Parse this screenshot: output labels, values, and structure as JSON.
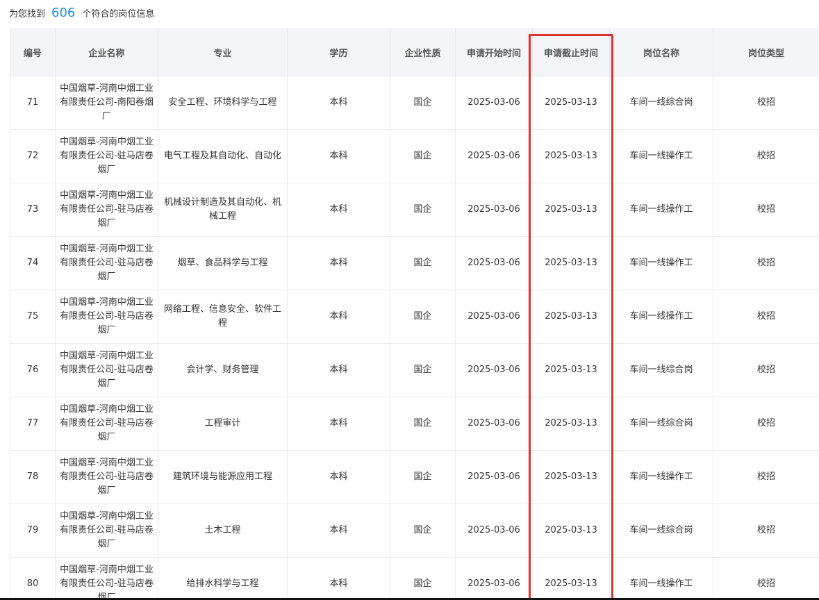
{
  "result": {
    "prefix": "为您找到",
    "count": "606",
    "suffix": "个符合的岗位信息"
  },
  "table": {
    "headers": [
      "编号",
      "企业名称",
      "专业",
      "学历",
      "企业性质",
      "申请开始时间",
      "申请截止时间",
      "岗位名称",
      "岗位类型"
    ],
    "rows": [
      {
        "id": "71",
        "company": "中国烟草-河南中烟工业有限责任公司-南阳卷烟厂",
        "major": "安全工程、环境科学与工程",
        "degree": "本科",
        "nature": "国企",
        "start": "2025-03-06",
        "end": "2025-03-13",
        "position": "车间一线综合岗",
        "type": "校招"
      },
      {
        "id": "72",
        "company": "中国烟草-河南中烟工业有限责任公司-驻马店卷烟厂",
        "major": "电气工程及其自动化、自动化",
        "degree": "本科",
        "nature": "国企",
        "start": "2025-03-06",
        "end": "2025-03-13",
        "position": "车间一线操作工",
        "type": "校招"
      },
      {
        "id": "73",
        "company": "中国烟草-河南中烟工业有限责任公司-驻马店卷烟厂",
        "major": "机械设计制造及其自动化、机械工程",
        "degree": "本科",
        "nature": "国企",
        "start": "2025-03-06",
        "end": "2025-03-13",
        "position": "车间一线操作工",
        "type": "校招"
      },
      {
        "id": "74",
        "company": "中国烟草-河南中烟工业有限责任公司-驻马店卷烟厂",
        "major": "烟草、食品科学与工程",
        "degree": "本科",
        "nature": "国企",
        "start": "2025-03-06",
        "end": "2025-03-13",
        "position": "车间一线操作工",
        "type": "校招"
      },
      {
        "id": "75",
        "company": "中国烟草-河南中烟工业有限责任公司-驻马店卷烟厂",
        "major": "网络工程、信息安全、软件工程",
        "degree": "本科",
        "nature": "国企",
        "start": "2025-03-06",
        "end": "2025-03-13",
        "position": "车间一线操作工",
        "type": "校招"
      },
      {
        "id": "76",
        "company": "中国烟草-河南中烟工业有限责任公司-驻马店卷烟厂",
        "major": "会计学、财务管理",
        "degree": "本科",
        "nature": "国企",
        "start": "2025-03-06",
        "end": "2025-03-13",
        "position": "车间一线综合岗",
        "type": "校招"
      },
      {
        "id": "77",
        "company": "中国烟草-河南中烟工业有限责任公司-驻马店卷烟厂",
        "major": "工程审计",
        "degree": "本科",
        "nature": "国企",
        "start": "2025-03-06",
        "end": "2025-03-13",
        "position": "车间一线综合岗",
        "type": "校招"
      },
      {
        "id": "78",
        "company": "中国烟草-河南中烟工业有限责任公司-驻马店卷烟厂",
        "major": "建筑环境与能源应用工程",
        "degree": "本科",
        "nature": "国企",
        "start": "2025-03-06",
        "end": "2025-03-13",
        "position": "车间一线操作工",
        "type": "校招"
      },
      {
        "id": "79",
        "company": "中国烟草-河南中烟工业有限责任公司-驻马店卷烟厂",
        "major": "土木工程",
        "degree": "本科",
        "nature": "国企",
        "start": "2025-03-06",
        "end": "2025-03-13",
        "position": "车间一线综合岗",
        "type": "校招"
      },
      {
        "id": "80",
        "company": "中国烟草-河南中烟工业有限责任公司-驻马店卷烟厂",
        "major": "给排水科学与工程",
        "degree": "本科",
        "nature": "国企",
        "start": "2025-03-06",
        "end": "2025-03-13",
        "position": "车间一线操作工",
        "type": "校招"
      }
    ]
  },
  "colors": {
    "accent": "#1f8fe5",
    "highlight": "#e03131",
    "header_bg": "#f3f5f8"
  }
}
